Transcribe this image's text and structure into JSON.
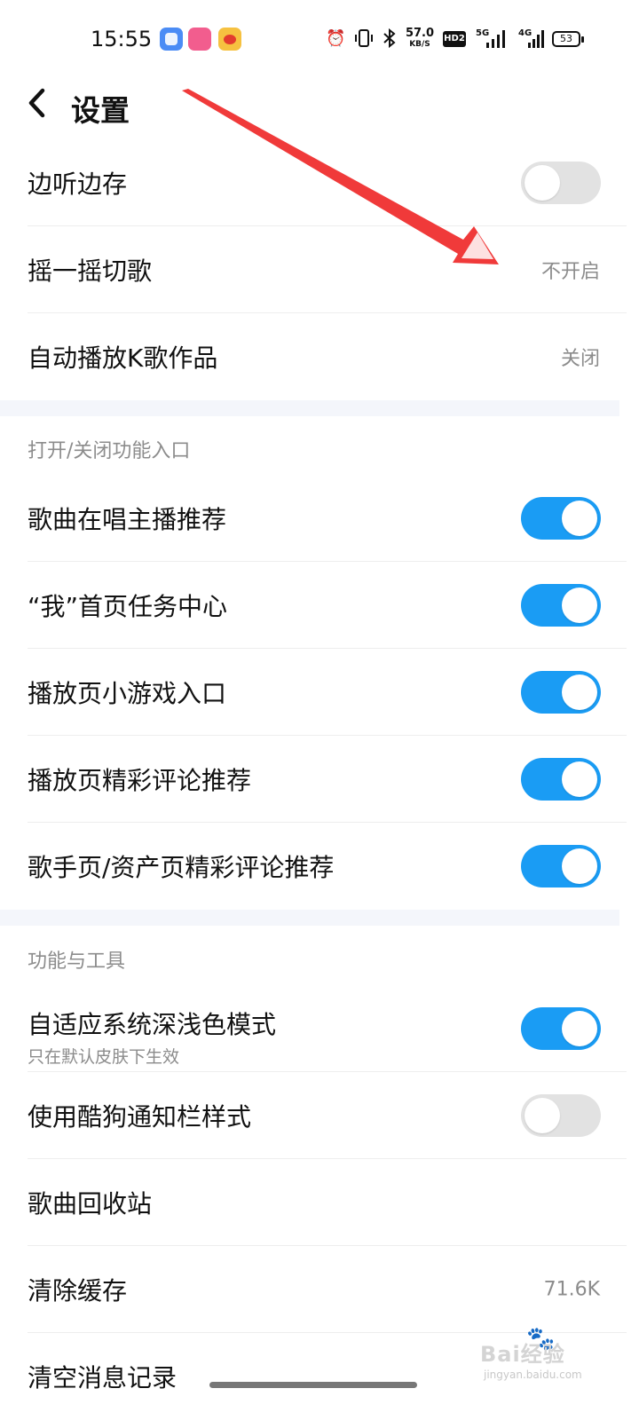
{
  "status_bar": {
    "time": "15:55",
    "speed_value": "57.0",
    "speed_unit": "KB/S",
    "hd_label": "HD2",
    "net1": "5G",
    "net2": "4G",
    "battery": "53"
  },
  "header": {
    "title": "设置"
  },
  "top_items": [
    {
      "label": "边听边存",
      "toggle": false
    },
    {
      "label": "摇一摇切歌",
      "value": "不开启"
    },
    {
      "label": "自动播放K歌作品",
      "value": "关闭"
    }
  ],
  "section_entry": {
    "title": "打开/关闭功能入口",
    "items": [
      {
        "label": "歌曲在唱主播推荐",
        "toggle": true
      },
      {
        "label": "“我”首页任务中心",
        "toggle": true
      },
      {
        "label": "播放页小游戏入口",
        "toggle": true
      },
      {
        "label": "播放页精彩评论推荐",
        "toggle": true
      },
      {
        "label": "歌手页/资产页精彩评论推荐",
        "toggle": true
      }
    ]
  },
  "section_tools": {
    "title": "功能与工具",
    "items": [
      {
        "label": "自适应系统深浅色模式",
        "sublabel": "只在默认皮肤下生效",
        "toggle": true
      },
      {
        "label": "使用酷狗通知栏样式",
        "toggle": false
      },
      {
        "label": "歌曲回收站"
      },
      {
        "label": "清除缓存",
        "value": "71.6K"
      },
      {
        "label": "清空消息记录"
      }
    ]
  },
  "watermark": {
    "brand": "Bai经验",
    "site": "jingyan.baidu.com"
  },
  "colors": {
    "toggle_on": "#1a9cf4",
    "toggle_off": "#e2e2e2",
    "annotation_arrow": "#f03a3a"
  }
}
